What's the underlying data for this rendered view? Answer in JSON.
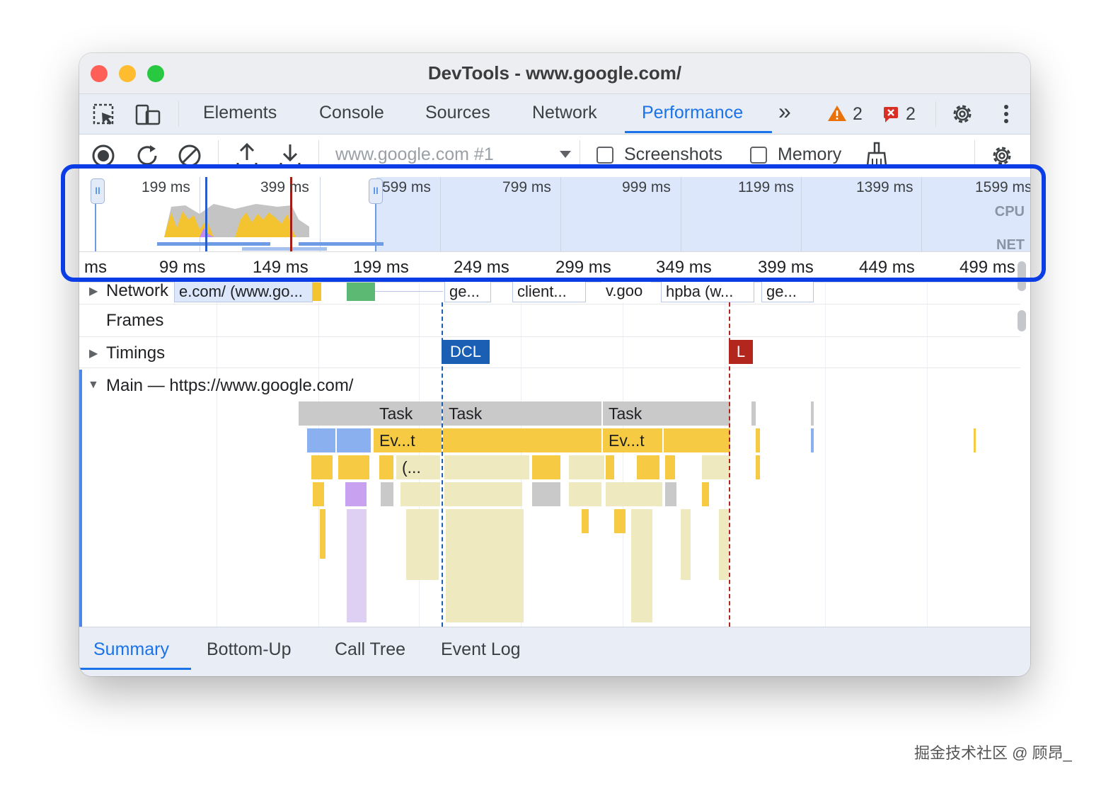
{
  "window": {
    "title": "DevTools - www.google.com/"
  },
  "tabs": {
    "items": [
      "Elements",
      "Console",
      "Sources",
      "Network",
      "Performance"
    ],
    "more_label": "»",
    "warnings_count": "2",
    "errors_count": "2"
  },
  "toolbar": {
    "recording_select": "www.google.com #1",
    "screenshots_label": "Screenshots",
    "memory_label": "Memory"
  },
  "overview": {
    "labels": [
      "199 ms",
      "399 ms",
      "599 ms",
      "799 ms",
      "999 ms",
      "1199 ms",
      "1399 ms",
      "1599 ms"
    ],
    "cpu_label": "CPU",
    "net_label": "NET"
  },
  "ruler": {
    "labels": [
      "ms",
      "99 ms",
      "149 ms",
      "199 ms",
      "249 ms",
      "299 ms",
      "349 ms",
      "399 ms",
      "449 ms",
      "499 ms"
    ]
  },
  "tracks": {
    "network_label": "Network",
    "network_items": [
      "e.com/ (www.go...",
      "ge...",
      "client...",
      "v.goo",
      "hpba (w...",
      "ge..."
    ],
    "frames_label": "Frames",
    "timings_label": "Timings",
    "dcl_label": "DCL",
    "l_label": "L",
    "main_label": "Main — https://www.google.com/",
    "task_labels": [
      "Task",
      "Task",
      "Task"
    ],
    "event_labels": [
      "Ev...t",
      "Ev...t"
    ],
    "sub_label": "(..."
  },
  "bottom_tabs": [
    "Summary",
    "Bottom-Up",
    "Call Tree",
    "Event Log"
  ],
  "watermark": "掘金技术社区 @ 顾昂_",
  "colors": {
    "accent": "#1a73e8",
    "highlight_border": "#0b3de6",
    "dcl": "#1a5fb4",
    "load": "#b3261e",
    "task": "#c9c9c9",
    "scripting": "#f6cb43"
  }
}
